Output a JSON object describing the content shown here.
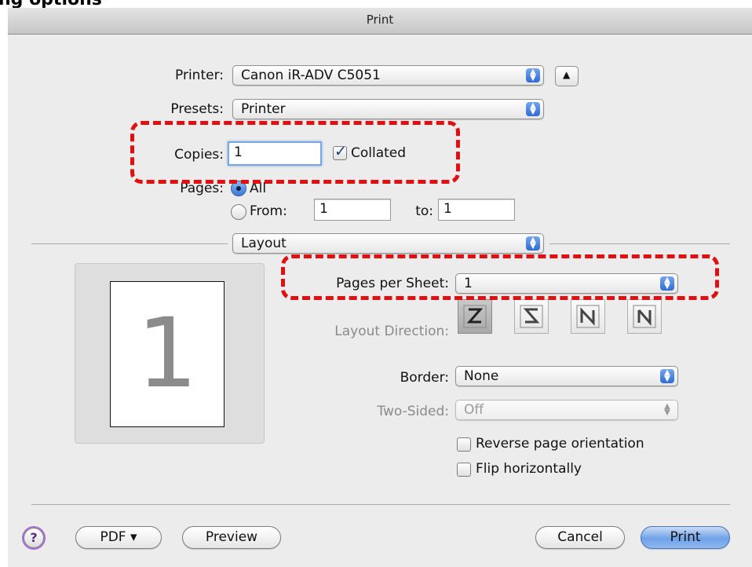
{
  "window": {
    "title": "Print"
  },
  "printer": {
    "label": "Printer:",
    "value": "Canon iR-ADV C5051",
    "disclosure_icon": "triangle-up-icon"
  },
  "presets": {
    "label": "Presets:",
    "value": "Printer"
  },
  "copies": {
    "label": "Copies:",
    "value": "1",
    "collated_label": "Collated",
    "collated": true
  },
  "pages": {
    "label": "Pages:",
    "all_label": "All",
    "from_label": "From:",
    "from_value": "1",
    "to_label": "to:",
    "to_value": "1",
    "selected": "All"
  },
  "section_popup": {
    "value": "Layout"
  },
  "preview": {
    "page_number": "1"
  },
  "pages_per_sheet": {
    "label": "Pages per Sheet:",
    "value": "1"
  },
  "layout_direction": {
    "label": "Layout Direction:",
    "buttons": [
      "z-direction-icon",
      "reverse-z-direction-icon",
      "n-direction-icon",
      "reverse-n-direction-icon"
    ],
    "selected_index": 0
  },
  "border": {
    "label": "Border:",
    "value": "None"
  },
  "two_sided": {
    "label": "Two-Sided:",
    "value": "Off"
  },
  "reverse_orientation": {
    "label": "Reverse page orientation",
    "checked": false
  },
  "flip_horizontally": {
    "label": "Flip horizontally",
    "checked": false
  },
  "footer": {
    "help_label": "?",
    "pdf_label": "PDF ▾",
    "preview_label": "Preview",
    "cancel_label": "Cancel",
    "print_label": "Print"
  },
  "colors": {
    "annotation_red": "#e01010",
    "accent_blue": "#3a78d6"
  }
}
